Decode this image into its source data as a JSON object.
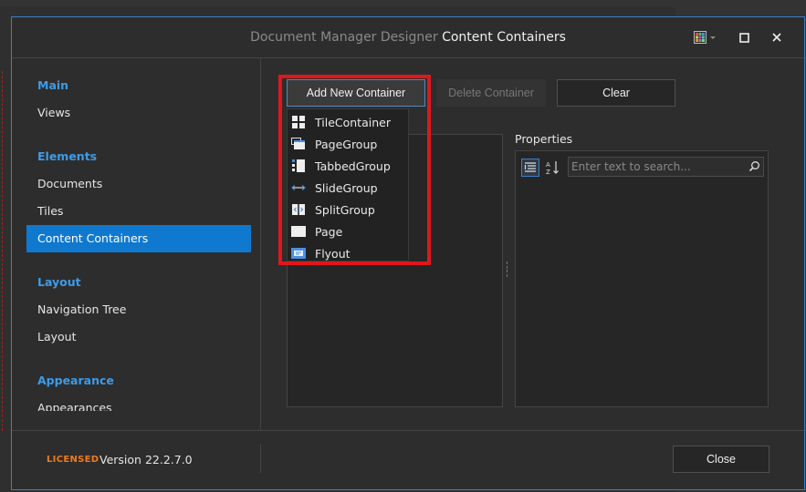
{
  "window": {
    "title_prefix": "Document Manager Designer",
    "title_section": "Content Containers",
    "controls": {
      "palette": "palette-icon",
      "maximize": "maximize-icon",
      "close": "close-icon"
    }
  },
  "sidebar": {
    "groups": [
      {
        "label": "Main",
        "items": [
          "Views"
        ]
      },
      {
        "label": "Elements",
        "items": [
          "Documents",
          "Tiles",
          "Content Containers"
        ]
      },
      {
        "label": "Layout",
        "items": [
          "Navigation Tree",
          "Layout"
        ]
      },
      {
        "label": "Appearance",
        "items": [
          "Appearances"
        ]
      }
    ],
    "active_item": "Content Containers"
  },
  "toolbar": {
    "add_label": "Add New Container",
    "delete_label": "Delete Container",
    "clear_label": "Clear"
  },
  "dropdown": {
    "items": [
      {
        "label": "TileContainer",
        "icon": "tile-container-icon"
      },
      {
        "label": "PageGroup",
        "icon": "page-group-icon"
      },
      {
        "label": "TabbedGroup",
        "icon": "tabbed-group-icon"
      },
      {
        "label": "SlideGroup",
        "icon": "slide-group-icon"
      },
      {
        "label": "SplitGroup",
        "icon": "split-group-icon"
      },
      {
        "label": "Page",
        "icon": "page-icon"
      },
      {
        "label": "Flyout",
        "icon": "flyout-icon"
      }
    ]
  },
  "properties": {
    "label": "Properties",
    "search_placeholder": "Enter text to search..."
  },
  "footer": {
    "licensed": "LICENSED",
    "version": "Version 22.2.7.0",
    "close_label": "Close"
  },
  "colors": {
    "accent": "#3d9be9",
    "active_nav": "#0f79d0",
    "highlight": "#e0161c",
    "licensed": "#f07a1a",
    "dialog_border": "#3a7fc8"
  }
}
